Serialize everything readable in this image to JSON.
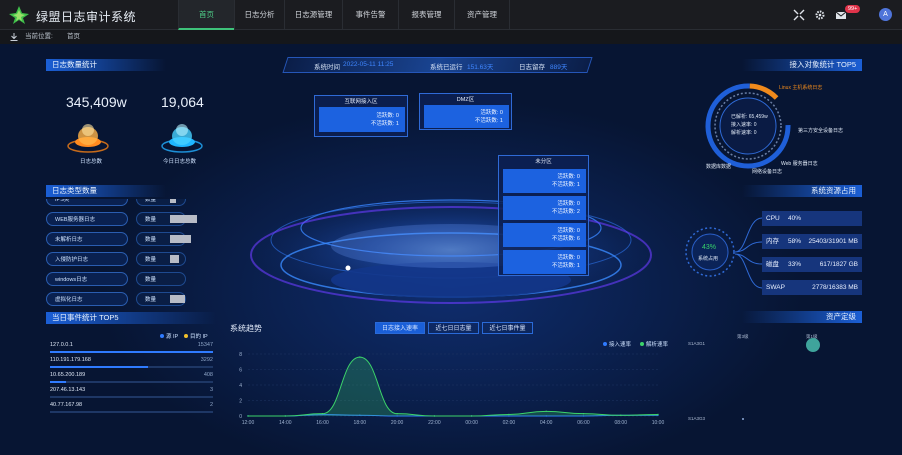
{
  "app": {
    "title": "绿盟日志审计系统"
  },
  "nav": [
    {
      "label": "首页",
      "active": true
    },
    {
      "label": "日志分析"
    },
    {
      "label": "日志源管理"
    },
    {
      "label": "事件告警"
    },
    {
      "label": "报表管理"
    },
    {
      "label": "资产管理"
    }
  ],
  "topright": {
    "badge": "99+",
    "avatar": "A",
    "icons": [
      "expand-icon",
      "gear-icon",
      "mail-icon",
      "user-avatar"
    ]
  },
  "breadcrumb": {
    "prefix": "当前位置:",
    "current": "首页"
  },
  "status_bar": {
    "time_label": "系统时间",
    "time_value": "2022-05-11 11:25",
    "uptime_label": "系统已运行",
    "uptime_value": "151.63天",
    "retention_label": "日志留存",
    "retention_value": "889天"
  },
  "log_stats": {
    "title": "日志数量统计",
    "total_value": "345,409w",
    "total_label": "日志总数",
    "today_value": "19,064",
    "today_label": "今日日志总数"
  },
  "log_types": {
    "title": "日志类型数量",
    "rows": [
      {
        "name": "IPS类",
        "count_label": "数量",
        "bar": 0.2
      },
      {
        "name": "WEB服务器日志",
        "count_label": "数量",
        "bar": 0.9
      },
      {
        "name": "未解析日志",
        "count_label": "数量",
        "bar": 0.7
      },
      {
        "name": "入侵防护日志",
        "count_label": "数量",
        "bar": 0.3
      },
      {
        "name": "windows日志",
        "count_label": "数量",
        "bar": 0.0
      },
      {
        "name": "虚拟化日志",
        "count_label": "数量",
        "bar": 0.5
      }
    ]
  },
  "events_top5": {
    "title": "当日事件统计 TOP5",
    "legend_src": "源 IP",
    "legend_dst": "目的 IP",
    "rows": [
      {
        "ip": "127.0.0.1",
        "count": "15347",
        "fill": 1.0
      },
      {
        "ip": "110.191.179.168",
        "count": "3292",
        "fill": 0.6
      },
      {
        "ip": "10.65.200.189",
        "count": "408",
        "fill": 0.1
      },
      {
        "ip": "207.46.13.143",
        "count": "3",
        "fill": 0.0
      },
      {
        "ip": "40.77.167.98",
        "count": "2",
        "fill": 0.0
      }
    ]
  },
  "zones": {
    "internet": {
      "title": "互联网接入区",
      "active": "活跃数: 0",
      "inactive": "不活跃数: 1"
    },
    "dmz": {
      "title": "DMZ区",
      "active": "活跃数: 0",
      "inactive": "不活跃数: 1"
    },
    "unassigned": {
      "title": "未分区",
      "items": [
        {
          "active": "活跃数: 0",
          "inactive": "不活跃数: 1"
        },
        {
          "active": "活跃数: 0",
          "inactive": "不活跃数: 2"
        },
        {
          "active": "活跃数: 0",
          "inactive": "不活跃数: 6"
        },
        {
          "active": "活跃数: 0",
          "inactive": "不活跃数: 1"
        }
      ]
    }
  },
  "access_top5": {
    "title": "接入对象统计 TOP5",
    "center_lines": [
      "已解析: 65,459w",
      "接入速率: 0",
      "解析速率: 0"
    ],
    "labels": [
      "Linux 主机系统日志",
      "第三方安全设备日志",
      "Web 服务器日志",
      "网络设备日志",
      "数据库数据"
    ]
  },
  "resources": {
    "title": "系统资源占用",
    "gauge_value": "43%",
    "gauge_label": "系统占用",
    "rows": [
      {
        "name": "CPU",
        "pct": "40%",
        "detail": ""
      },
      {
        "name": "内存",
        "pct": "58%",
        "detail": "25403/31901 MB"
      },
      {
        "name": "磁盘",
        "pct": "33%",
        "detail": "617/1827 GB"
      },
      {
        "name": "SWAP",
        "pct": "",
        "detail": "2778/16383 MB"
      }
    ]
  },
  "assets": {
    "title": "资产定级",
    "col_labels": [
      "第3级",
      "第1级"
    ],
    "row_labels": [
      "S1A3G1",
      "S1A3G3"
    ]
  },
  "trend": {
    "title": "系统趋势",
    "tabs": [
      "日志接入速率",
      "近七日日志量",
      "近七日事件量"
    ],
    "legend": [
      "接入速率",
      "解析速率"
    ]
  },
  "chart_data": {
    "type": "line",
    "title": "系统趋势",
    "x": [
      "12:00",
      "14:00",
      "16:00",
      "18:00",
      "20:00",
      "22:00",
      "00:00",
      "02:00",
      "04:00",
      "06:00",
      "08:00",
      "10:00"
    ],
    "ylim": [
      0,
      8
    ],
    "yticks": [
      0,
      2,
      4,
      6,
      8
    ],
    "series": [
      {
        "name": "接入速率",
        "color": "#2f7bff",
        "values": [
          0,
          0,
          0.2,
          0.1,
          0,
          0,
          0,
          0,
          0,
          0,
          0.1,
          0.1
        ]
      },
      {
        "name": "解析速率",
        "color": "#3cd46a",
        "values": [
          0,
          0,
          0.3,
          7.6,
          0.3,
          0,
          0,
          0.2,
          0.6,
          0.3,
          0.1,
          0.2
        ]
      }
    ],
    "grid": true,
    "legend": "top-right"
  }
}
